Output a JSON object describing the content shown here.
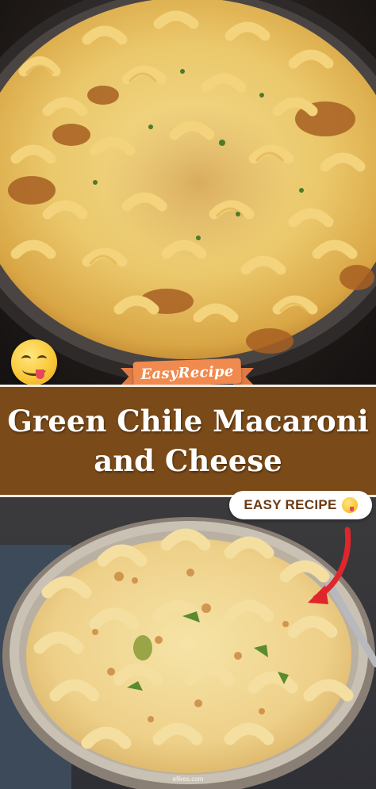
{
  "title": {
    "line1": "Green Chile Macaroni",
    "line2": "and Cheese"
  },
  "ribbon": {
    "label": "EasyRecipe"
  },
  "badge": {
    "label": "EASY RECIPE"
  },
  "watermark": {
    "text": "efiires.com"
  },
  "icons": {
    "top_emoji": "face-savoring-food-icon",
    "badge_emoji": "face-savoring-food-icon",
    "arrow": "red-curved-arrow-icon"
  },
  "colors": {
    "title_band": "#7a4a18",
    "ribbon": "#f08a4f",
    "badge_text": "#6b3a12",
    "arrow": "#e0262b"
  }
}
